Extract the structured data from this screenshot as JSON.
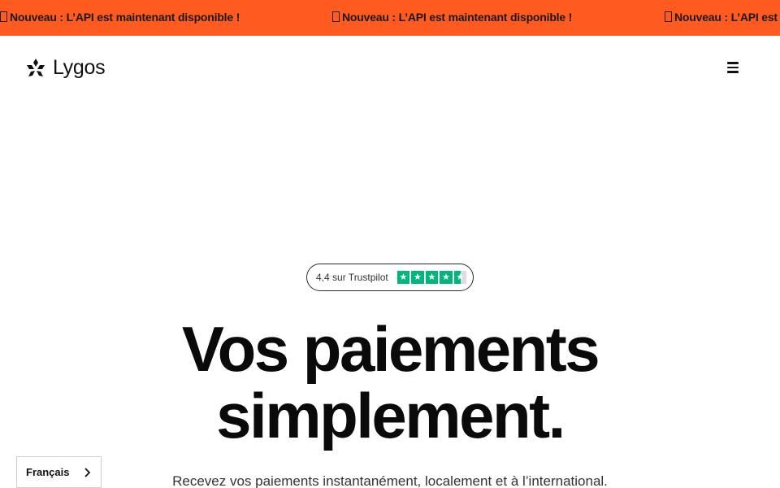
{
  "banner": {
    "message": "Nouveau : L’API est maintenant disponible !",
    "color": "#ff5a1f"
  },
  "header": {
    "logo_text": "Lygos",
    "logo_icon": "lygos-flower-icon",
    "menu_icon": "hamburger-menu-icon"
  },
  "trustpilot": {
    "label": "4,4 sur Trustpilot",
    "rating": 4.4,
    "max": 5,
    "star_color": "#00b67a"
  },
  "hero": {
    "title_line1": "Vos paiements",
    "title_line2": "simplement.",
    "subtitle": "Recevez vos paiements instantanément, localement et à l’international."
  },
  "language": {
    "selected": "Français",
    "icon": "chevron-right-icon"
  }
}
